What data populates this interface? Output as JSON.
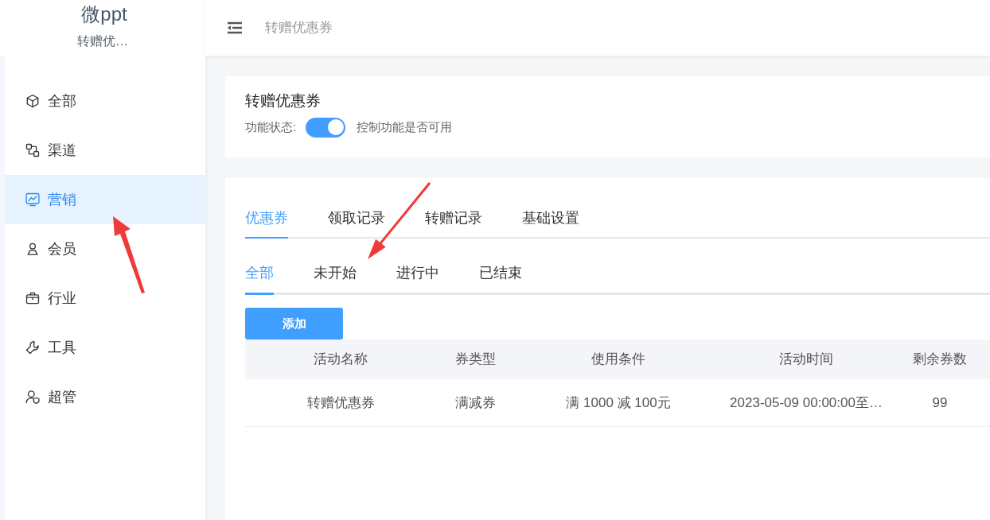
{
  "sidebar": {
    "logo": "微ppt",
    "subtitle": "转赠优…",
    "items": [
      {
        "label": "全部",
        "selected": false
      },
      {
        "label": "渠道",
        "selected": false
      },
      {
        "label": "营销",
        "selected": true
      },
      {
        "label": "会员",
        "selected": false
      },
      {
        "label": "行业",
        "selected": false
      },
      {
        "label": "工具",
        "selected": false
      },
      {
        "label": "超管",
        "selected": false
      }
    ]
  },
  "header": {
    "breadcrumb": "转赠优惠券"
  },
  "feature_card": {
    "title": "转赠优惠券",
    "status_label": "功能状态:",
    "switch_on": true,
    "hint": "控制功能是否可用"
  },
  "tabs": [
    {
      "label": "优惠券",
      "selected": true
    },
    {
      "label": "领取记录",
      "selected": false
    },
    {
      "label": "转赠记录",
      "selected": false
    },
    {
      "label": "基础设置",
      "selected": false
    }
  ],
  "sub_tabs": [
    {
      "label": "全部",
      "selected": true
    },
    {
      "label": "未开始",
      "selected": false
    },
    {
      "label": "进行中",
      "selected": false
    },
    {
      "label": "已结束",
      "selected": false
    }
  ],
  "add_button": "添加",
  "table": {
    "columns": [
      "活动名称",
      "券类型",
      "使用条件",
      "活动时间",
      "剩余券数"
    ],
    "rows": [
      [
        "转赠优惠券",
        "满减券",
        "满 1000 减 100元",
        "2023-05-09 00:00:00至…",
        "99"
      ]
    ]
  }
}
